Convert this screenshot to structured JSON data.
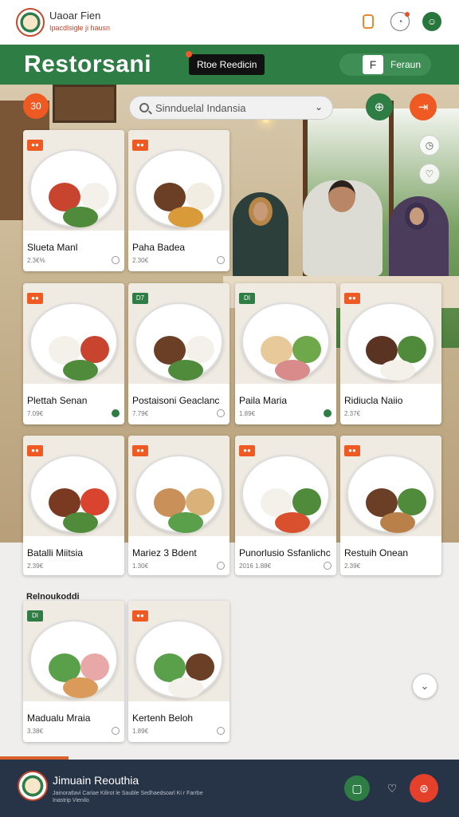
{
  "topbar": {
    "brand_name": "Uaoar Fien",
    "brand_tagline": "Ipacdlsigle ji hausn",
    "icons": [
      "bookmark-icon",
      "notification-icon",
      "profile-icon"
    ]
  },
  "header": {
    "title": "Restorsani",
    "reserve_label": "Rtoe Reedicin",
    "toggle_knob": "F",
    "toggle_label": "Feraun"
  },
  "search": {
    "placeholder": "Sinnduelal Indansia",
    "chevron": "⌄"
  },
  "badge": "30",
  "cards": [
    {
      "name": "Slueta Manl",
      "price": "2.3€%",
      "tag": "●●"
    },
    {
      "name": "Paha Badea",
      "price": "2.30€",
      "tag": "●●"
    },
    {
      "name": "Plettah Senan",
      "price": "7.09€",
      "tag": "●●"
    },
    {
      "name": "Postaisoni Geaclanc",
      "price": "7.79€",
      "tag": "D7"
    },
    {
      "name": "Paila Maria",
      "price": "1.89€",
      "tag": "DI"
    },
    {
      "name": "Ridiucla Naiio",
      "price": "2.37€",
      "tag": "●●"
    },
    {
      "name": "Batalli Miitsia",
      "price": "2.39€",
      "tag": "●●"
    },
    {
      "name": "Mariez 3  Bdent",
      "price": "1.30€",
      "tag": "●●"
    },
    {
      "name": "Punorlusio Ssfanlichc",
      "price": "2016 1.88€",
      "tag": "●●"
    },
    {
      "name": "Restuih Onean",
      "price": "2.39€",
      "tag": "●●"
    },
    {
      "name": "Madualu Mraia",
      "price": "3.38€",
      "tag": "DI"
    },
    {
      "name": "Kertenh Beloh",
      "price": "1.89€",
      "tag": "●●"
    }
  ],
  "section_label": "Relnoukoddi",
  "footer": {
    "title": "Jimuain Reouthia",
    "subtitle": "Jainoratlavi Cariae Kilirot le Sauble Sedhaedsoarl Ki r Farrbe Inastrip Vienilo"
  },
  "colors": {
    "brand_green": "#2e7d45",
    "accent_orange": "#ef5a22",
    "footer_bg": "#273346"
  }
}
